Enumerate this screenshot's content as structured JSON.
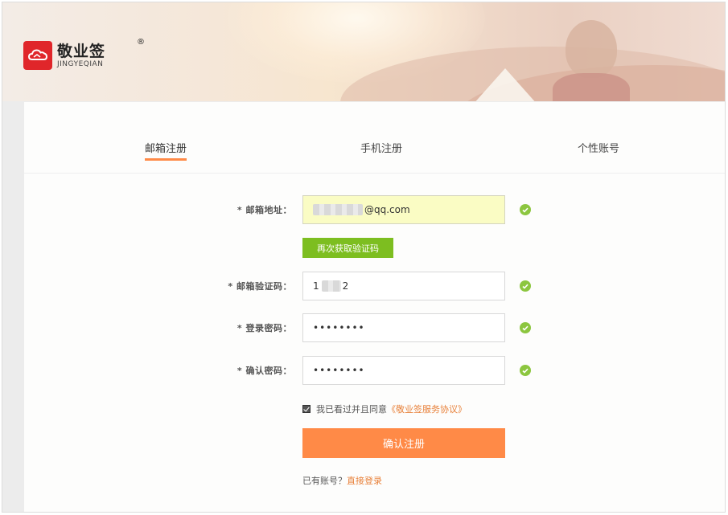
{
  "brand": {
    "name_cn": "敬业签",
    "name_en": "JINGYEQIAN",
    "registered": "®",
    "accent": "#e0262a"
  },
  "tabs": [
    {
      "label": "邮箱注册",
      "active": true
    },
    {
      "label": "手机注册",
      "active": false
    },
    {
      "label": "个性账号",
      "active": false
    }
  ],
  "form": {
    "email": {
      "label": "* 邮箱地址：",
      "value_suffix": "@qq.com",
      "valid": true
    },
    "resend_code_label": "再次获取验证码",
    "code": {
      "label": "* 邮箱验证码：",
      "value_start": "1",
      "value_end": "2",
      "valid": true
    },
    "password": {
      "label": "* 登录密码：",
      "value": "••••••••",
      "valid": true
    },
    "confirm_password": {
      "label": "* 确认密码：",
      "value": "••••••••",
      "valid": true
    },
    "agreement": {
      "checked": true,
      "text": "我已看过并且同意",
      "link": "《敬业签服务协议》"
    },
    "submit_label": "确认注册",
    "login_prompt": "已有账号？",
    "login_link": "直接登录"
  },
  "colors": {
    "orange": "#ff8a47",
    "green_button": "#7dbe20",
    "check_green": "#8cc63f",
    "link": "#e8813a",
    "highlight_field": "#fafcc4"
  }
}
